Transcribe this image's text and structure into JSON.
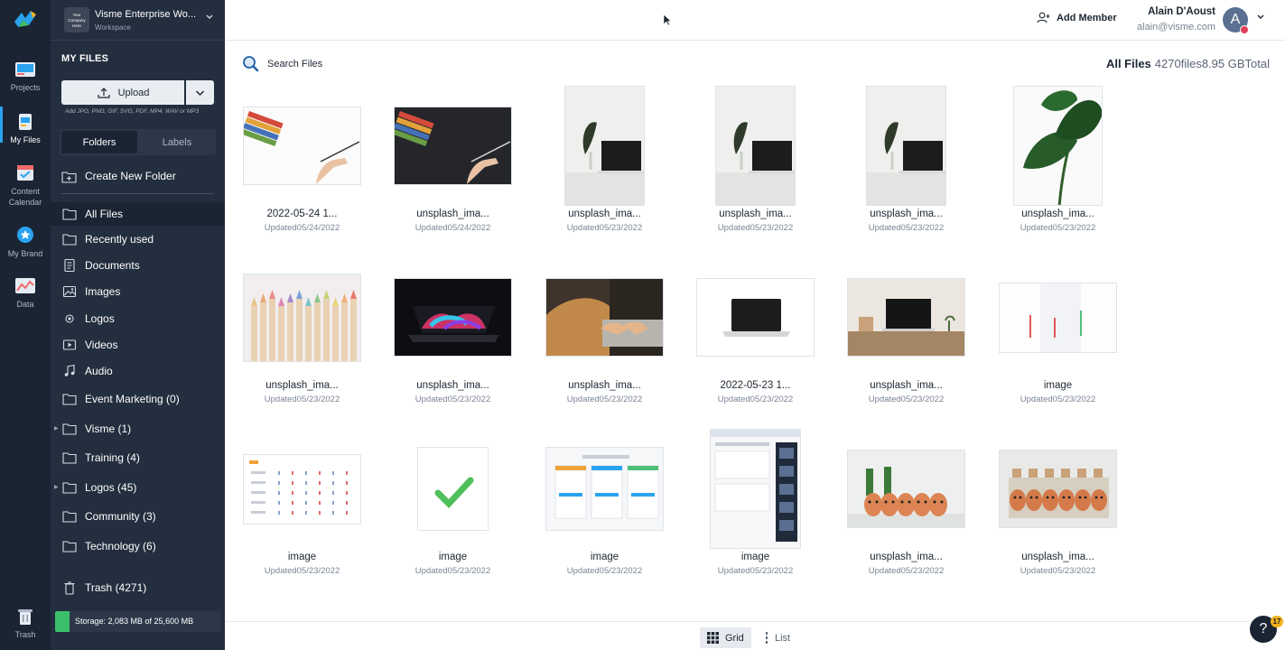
{
  "rail": {
    "items": [
      {
        "label": "Projects",
        "icon": "projects-icon"
      },
      {
        "label": "My Files",
        "icon": "my-files-icon"
      },
      {
        "label": "Content Calendar",
        "icon": "calendar-icon"
      },
      {
        "label": "My Brand",
        "icon": "brand-icon"
      },
      {
        "label": "Data",
        "icon": "data-icon"
      },
      {
        "label": "Trash",
        "icon": "trash-icon"
      }
    ],
    "active": "My Files"
  },
  "workspace": {
    "name": "Visme Enterprise Wo...",
    "subtitle": "Workspace",
    "logo_text": "Your Company Here"
  },
  "sidebar": {
    "title": "MY FILES",
    "upload_label": "Upload",
    "upload_hint": "Add JPG, PNG, GIF, SVG, PDF, MP4, WAV or MP3",
    "tabs": [
      "Folders",
      "Labels"
    ],
    "create_folder": "Create New Folder",
    "nav": [
      {
        "label": "All Files",
        "icon": "folder-icon",
        "active": true
      },
      {
        "label": "Recently used",
        "icon": "folder-icon"
      },
      {
        "label": "Documents",
        "icon": "document-icon"
      },
      {
        "label": "Images",
        "icon": "image-icon"
      },
      {
        "label": "Logos",
        "icon": "logo-icon"
      },
      {
        "label": "Videos",
        "icon": "video-icon"
      },
      {
        "label": "Audio",
        "icon": "audio-icon"
      },
      {
        "label": "Event Marketing (0)",
        "icon": "folder-icon"
      },
      {
        "label": "Visme (1)",
        "icon": "folder-icon",
        "expandable": true
      },
      {
        "label": "Training (4)",
        "icon": "folder-icon"
      },
      {
        "label": "Logos (45)",
        "icon": "folder-icon",
        "expandable": true
      },
      {
        "label": "Community (3)",
        "icon": "folder-icon"
      },
      {
        "label": "Technology (6)",
        "icon": "folder-icon"
      }
    ],
    "trash": "Trash (4271)",
    "storage": "Storage: 2,083 MB of 25,600 MB",
    "storage_fraction": 0.081
  },
  "header": {
    "add_member": "Add Member",
    "user_name": "Alain D'Aoust",
    "user_email": "alain@visme.com",
    "avatar_initial": "A"
  },
  "toolbar": {
    "search_label": "Search Files",
    "summary_label": "All Files",
    "summary_value": "4270files8.95 GBTotal"
  },
  "files": [
    {
      "name": "2022-05-24 1...",
      "date": "Updated05/24/2022",
      "kind": "pencils-hand-white"
    },
    {
      "name": "unsplash_ima...",
      "date": "Updated05/24/2022",
      "kind": "pencils-hand-dark"
    },
    {
      "name": "unsplash_ima...",
      "date": "Updated05/23/2022",
      "kind": "laptop-plant"
    },
    {
      "name": "unsplash_ima...",
      "date": "Updated05/23/2022",
      "kind": "laptop-plant"
    },
    {
      "name": "unsplash_ima...",
      "date": "Updated05/23/2022",
      "kind": "laptop-plant"
    },
    {
      "name": "unsplash_ima...",
      "date": "Updated05/23/2022",
      "kind": "monstera"
    },
    {
      "name": "unsplash_ima...",
      "date": "Updated05/23/2022",
      "kind": "colored-pencils"
    },
    {
      "name": "unsplash_ima...",
      "date": "Updated05/23/2022",
      "kind": "rgb-laptop"
    },
    {
      "name": "unsplash_ima...",
      "date": "Updated05/23/2022",
      "kind": "typing"
    },
    {
      "name": "2022-05-23 1...",
      "date": "Updated05/23/2022",
      "kind": "laptop-white"
    },
    {
      "name": "unsplash_ima...",
      "date": "Updated05/23/2022",
      "kind": "laptop-desk"
    },
    {
      "name": "image",
      "date": "Updated05/23/2022",
      "kind": "candles"
    },
    {
      "name": "image",
      "date": "Updated05/23/2022",
      "kind": "table-doc"
    },
    {
      "name": "image",
      "date": "Updated05/23/2022",
      "kind": "checkmark"
    },
    {
      "name": "image",
      "date": "Updated05/23/2022",
      "kind": "pricing"
    },
    {
      "name": "image",
      "date": "Updated05/23/2022",
      "kind": "app-screenshot"
    },
    {
      "name": "unsplash_ima...",
      "date": "Updated05/23/2022",
      "kind": "eggs"
    },
    {
      "name": "unsplash_ima...",
      "date": "Updated05/23/2022",
      "kind": "eggs-crate"
    }
  ],
  "view": {
    "grid_label": "Grid",
    "list_label": "List",
    "active": "Grid"
  },
  "help": {
    "badge": "17"
  },
  "colors": {
    "rail_bg": "#1a2433",
    "sidebar_bg": "#232e3e",
    "accent": "#2aa3ef",
    "storage": "#3cbf6a"
  }
}
